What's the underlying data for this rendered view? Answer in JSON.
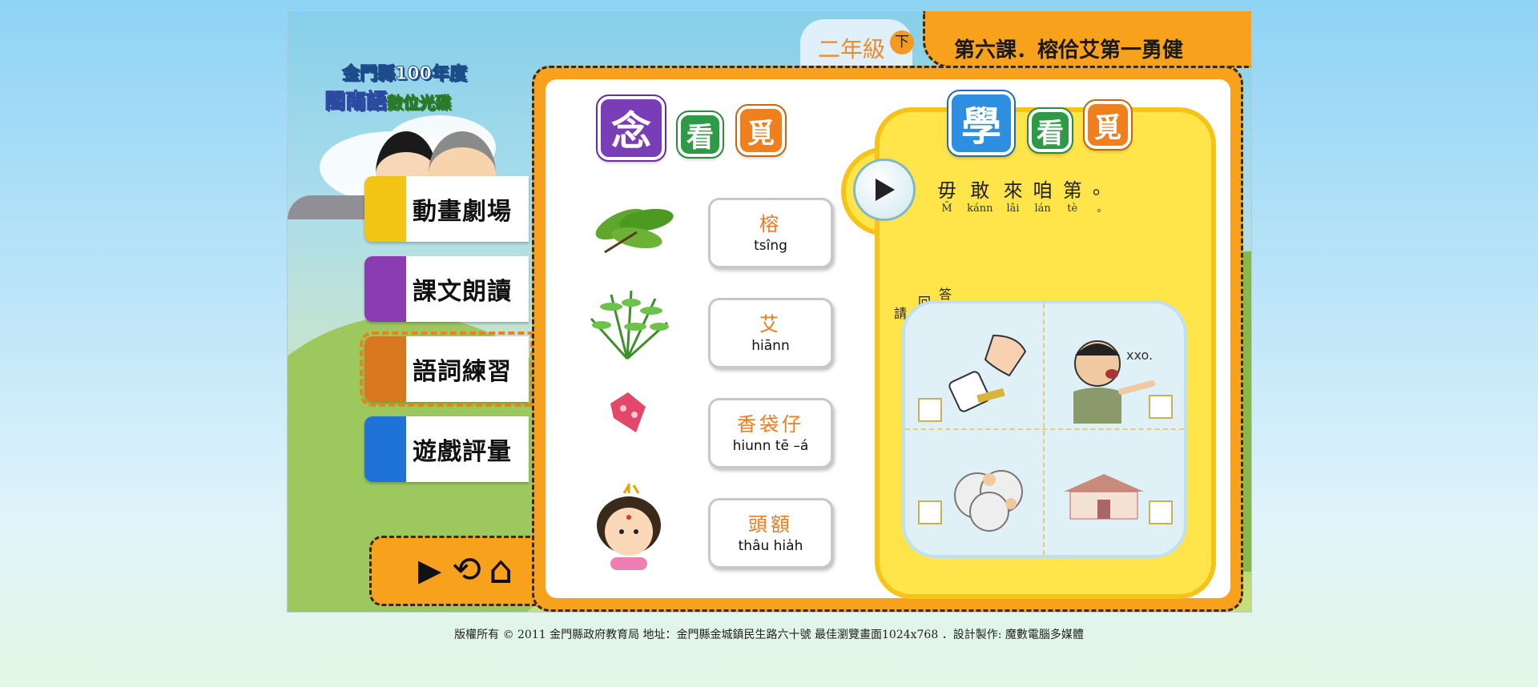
{
  "header": {
    "grade_label": "二年級",
    "grade_term": "下",
    "lesson_title": "第六課．榕佮艾第一勇健"
  },
  "logo": {
    "line1": "金門縣100年度",
    "line2_a": "閩南語",
    "line2_b": "數位光碟"
  },
  "sidebar": {
    "items": [
      {
        "label": "動畫劇場",
        "color": "#f2c414"
      },
      {
        "label": "課文朗讀",
        "color": "#8a3db0"
      },
      {
        "label": "語詞練習",
        "color": "#d9781e"
      },
      {
        "label": "遊戲評量",
        "color": "#1f73d8"
      }
    ]
  },
  "controls": {
    "play_icon": "▶",
    "replay_icon": "⟲",
    "home_icon": "⌂"
  },
  "read_section": {
    "title_chars": [
      "念",
      "看",
      "覓"
    ]
  },
  "vocab": [
    {
      "hanzi": "榕",
      "roman": "tsîng",
      "icon": "banyan-leaves-icon"
    },
    {
      "hanzi": "艾",
      "roman": "hiānn",
      "icon": "mugwort-icon"
    },
    {
      "hanzi": "香袋仔",
      "roman": "hiunn tē –á",
      "icon": "sachet-icon"
    },
    {
      "hanzi": "頭額",
      "roman": "thâu hia̍h",
      "icon": "forehead-girl-icon"
    }
  ],
  "learn_section": {
    "title_chars": [
      "學",
      "看",
      "覓"
    ],
    "sentence": [
      {
        "h": "毋",
        "r": "M̄"
      },
      {
        "h": "敢",
        "r": "kánn"
      },
      {
        "h": "來",
        "r": "lâi"
      },
      {
        "h": "咱",
        "r": "lán"
      },
      {
        "h": "第",
        "r": "tè"
      },
      {
        "h": "。",
        "r": "。"
      }
    ],
    "prompt_chars": [
      "請",
      "回",
      "答"
    ]
  },
  "footer": {
    "text": "版權所有 © 2011  金門縣政府教育局  地址：金門縣金城鎮民生路六十號  最佳瀏覽畫面1024x768  ．設計製作: 魔數電腦多媒體"
  },
  "colors": {
    "accent_orange": "#f7a11d",
    "learn_yellow": "#ffe44a",
    "word_orange": "#f07a1e"
  }
}
